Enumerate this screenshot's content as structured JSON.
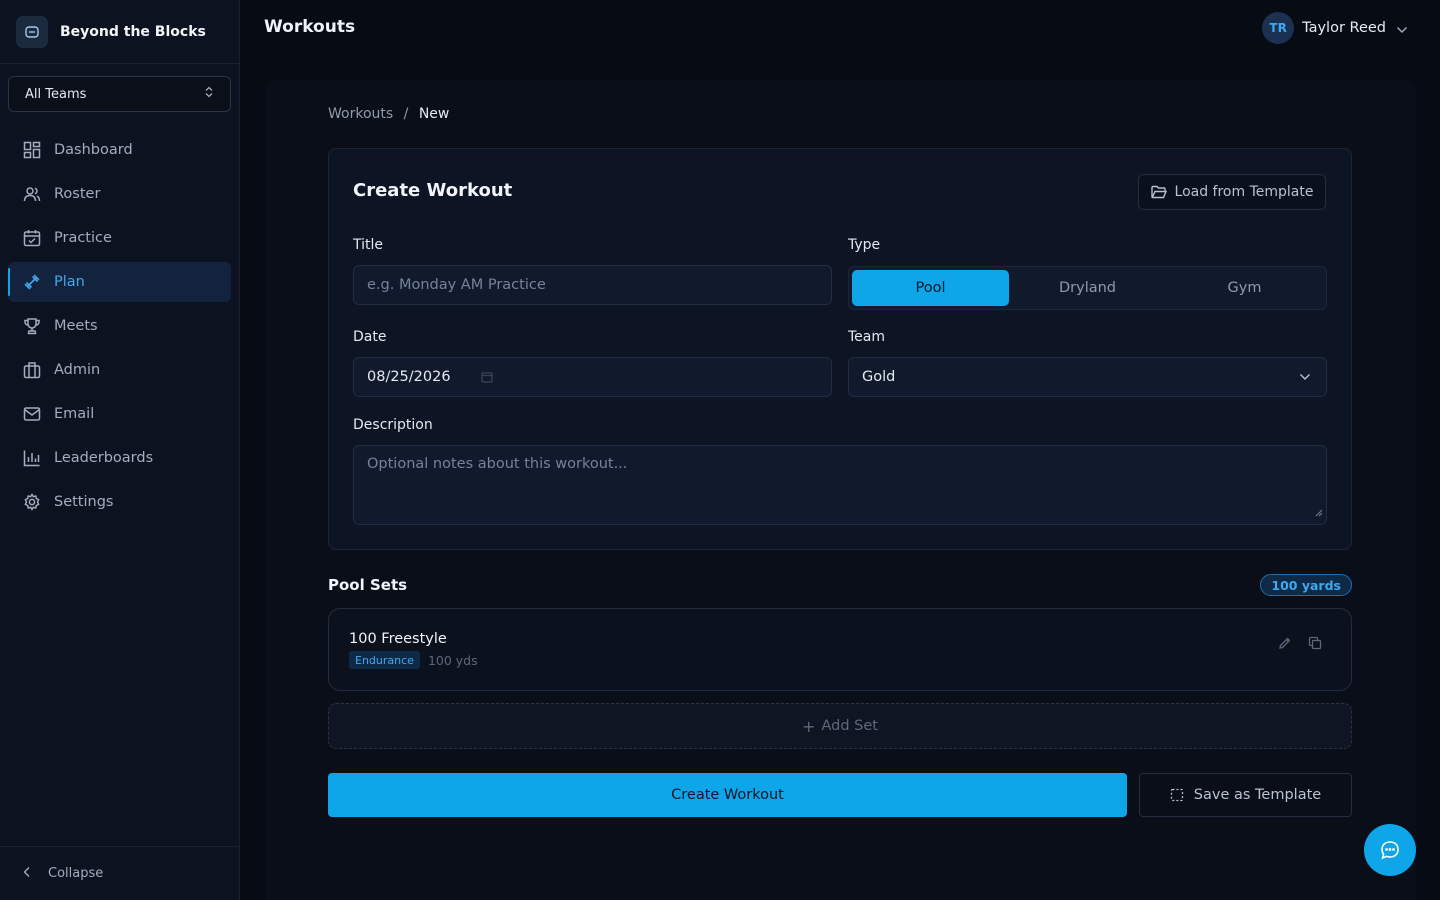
{
  "brand": {
    "name": "Beyond the Blocks",
    "logo_icon": "app-logo-icon"
  },
  "team_selector": {
    "value": "All Teams"
  },
  "sidebar": {
    "items": [
      {
        "label": "Dashboard",
        "icon": "dashboard-icon"
      },
      {
        "label": "Roster",
        "icon": "users-icon"
      },
      {
        "label": "Practice",
        "icon": "calendar-check-icon"
      },
      {
        "label": "Plan",
        "icon": "dumbbell-icon",
        "active": true
      },
      {
        "label": "Meets",
        "icon": "trophy-icon"
      },
      {
        "label": "Admin",
        "icon": "building-icon"
      },
      {
        "label": "Email",
        "icon": "mail-icon"
      },
      {
        "label": "Leaderboards",
        "icon": "bar-chart-icon"
      },
      {
        "label": "Settings",
        "icon": "gear-icon"
      }
    ],
    "collapse_label": "Collapse"
  },
  "header": {
    "title": "Workouts",
    "user": {
      "initials": "TR",
      "name": "Taylor Reed"
    }
  },
  "breadcrumb": {
    "parent": "Workouts",
    "separator": "/",
    "current": "New"
  },
  "form": {
    "title": "Create Workout",
    "load_template_label": "Load from Template",
    "title_label": "Title",
    "title_placeholder": "e.g. Monday AM Practice",
    "type_label": "Type",
    "type_options": [
      "Pool",
      "Dryland",
      "Gym"
    ],
    "type_selected": "Pool",
    "date_label": "Date",
    "date_value": "08/25/2026",
    "team_label": "Team",
    "team_value": "Gold",
    "description_label": "Description",
    "description_placeholder": "Optional notes about this workout..."
  },
  "pool_sets": {
    "title": "Pool Sets",
    "total_badge": "100 yards",
    "sets": [
      {
        "name": "100 Freestyle",
        "tag": "Endurance",
        "distance": "100 yds"
      }
    ],
    "add_label": "Add Set"
  },
  "actions": {
    "create_label": "Create Workout",
    "save_template_label": "Save as Template"
  },
  "colors": {
    "accent": "#0ea5e9",
    "background": "#070b13",
    "sidebar": "#0c1220",
    "card": "#0d1424"
  }
}
